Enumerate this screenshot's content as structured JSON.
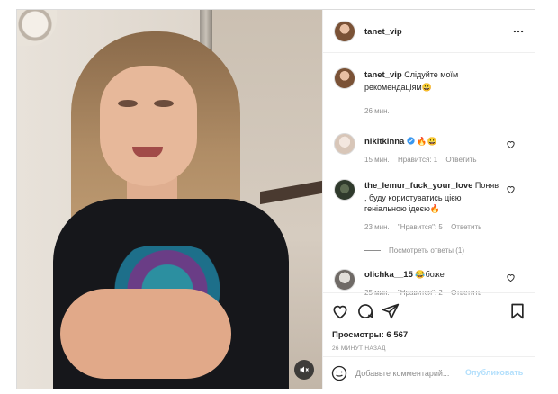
{
  "post": {
    "author": "tanet_vip",
    "more_icon": "more-horizontal-icon",
    "mute_icon": "muted-speaker-icon"
  },
  "caption": {
    "username": "tanet_vip",
    "text": "Слідуйте моїм рекомендаціям",
    "emoji": "😀",
    "time": "26 мин."
  },
  "comments": [
    {
      "username": "nikitkinna",
      "verified": true,
      "text": "🔥😀",
      "time": "15 мин.",
      "likes": "Нравится: 1",
      "reply": "Ответить"
    },
    {
      "username": "the_lemur_fuck_your_love",
      "text": "Поняв , буду користуватись цією геніальною ідеєю",
      "emoji": "🔥",
      "time": "23 мин.",
      "likes": "\"Нравится\": 5",
      "reply": "Ответить",
      "view_replies": "Посмотреть ответы (1)"
    },
    {
      "username": "olichka__15",
      "emoji": "😂",
      "text": "боже",
      "time": "25 мин.",
      "likes": "\"Нравится\": 2",
      "reply": "Ответить"
    }
  ],
  "actions": {
    "views": "Просмотры: 6 567",
    "timeago": "26 минут назад"
  },
  "composer": {
    "placeholder": "Добавьте комментарий...",
    "publish": "Опубликовать"
  },
  "colors": {
    "accent_blue": "#0095f6",
    "publish_disabled": "#b2dffc",
    "meta_gray": "#8e8e8e",
    "text": "#262626"
  }
}
